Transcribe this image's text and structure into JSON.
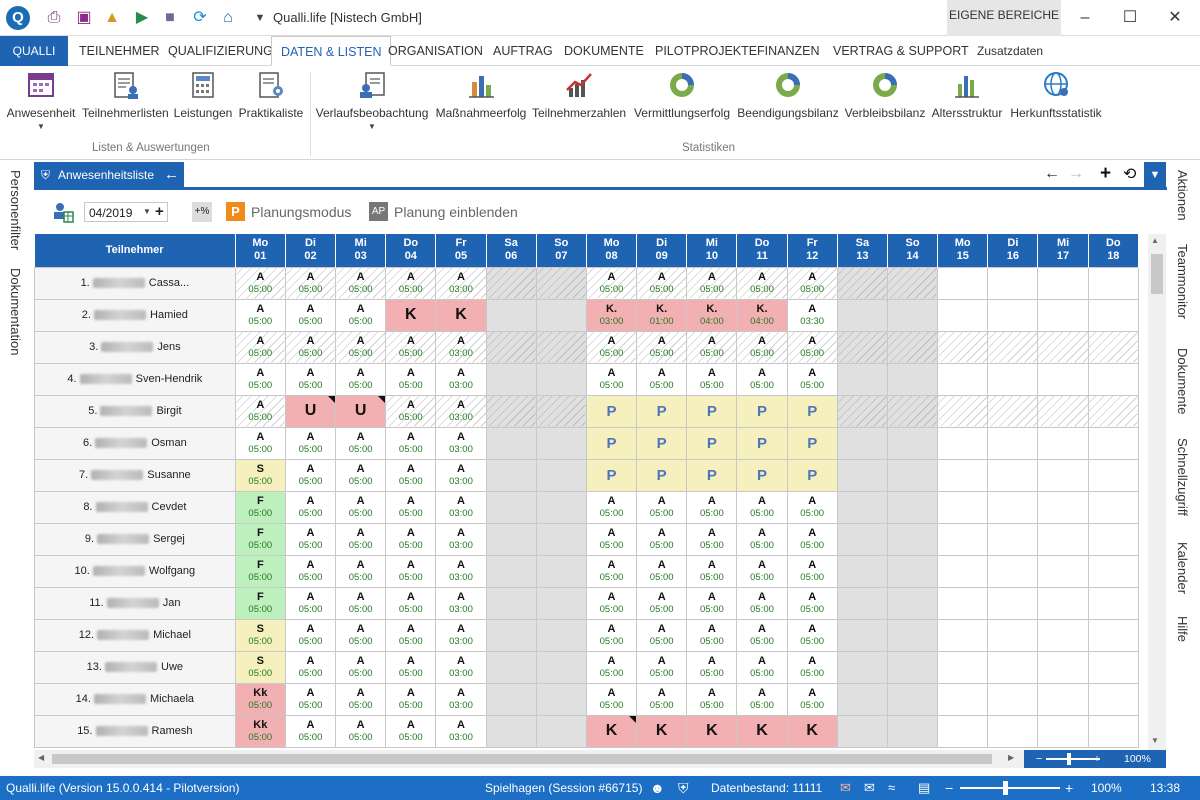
{
  "window": {
    "title": "Qualli.life [Nistech GmbH]",
    "eigene_bereiche": "EIGENE BEREICHE"
  },
  "menu": {
    "app": "QUALLI",
    "items": [
      "TEILNEHMER",
      "QUALIFIZIERUNG",
      "DATEN & LISTEN",
      "ORGANISATION",
      "AUFTRAG",
      "DOKUMENTE",
      "PILOTPROJEKTE",
      "FINANZEN",
      "VERTRAG & SUPPORT"
    ],
    "active": "DATEN & LISTEN",
    "zusatz": "Zusatzdaten"
  },
  "ribbon": {
    "group1": "Listen & Auswertungen",
    "group2": "Statistiken",
    "buttons": [
      "Anwesenheit",
      "Teilnehmerlisten",
      "Leistungen",
      "Praktikaliste",
      "Verlaufsbeobachtung",
      "Maßnahmeerfolg",
      "Teilnehmerzahlen",
      "Vermittlungserfolg",
      "Beendigungsbilanz",
      "Verbleibsbilanz",
      "Altersstruktur",
      "Herkunftsstatistik"
    ]
  },
  "left_rail": [
    "Personenfilter",
    "Dokumentation"
  ],
  "right_rail": [
    "Aktionen",
    "Teammonitor",
    "Dokumente",
    "Schnellzugriff",
    "Kalender",
    "Hilfe"
  ],
  "panel": {
    "tab": "Anwesenheitsliste"
  },
  "toolbar": {
    "month": "04/2019",
    "percent": "+%",
    "planning_mode": "Planungsmodus",
    "planning_show": "Planung einblenden",
    "plan_badge": "P",
    "ap_badge": "AP"
  },
  "grid": {
    "header_name": "Teilnehmer",
    "days": [
      {
        "dow": "Mo",
        "d": "01"
      },
      {
        "dow": "Di",
        "d": "02"
      },
      {
        "dow": "Mi",
        "d": "03"
      },
      {
        "dow": "Do",
        "d": "04"
      },
      {
        "dow": "Fr",
        "d": "05"
      },
      {
        "dow": "Sa",
        "d": "06"
      },
      {
        "dow": "So",
        "d": "07"
      },
      {
        "dow": "Mo",
        "d": "08"
      },
      {
        "dow": "Di",
        "d": "09"
      },
      {
        "dow": "Mi",
        "d": "10"
      },
      {
        "dow": "Do",
        "d": "11"
      },
      {
        "dow": "Fr",
        "d": "12"
      },
      {
        "dow": "Sa",
        "d": "13"
      },
      {
        "dow": "So",
        "d": "14"
      },
      {
        "dow": "Mo",
        "d": "15"
      },
      {
        "dow": "Di",
        "d": "16"
      },
      {
        "dow": "Mi",
        "d": "17"
      },
      {
        "dow": "Do",
        "d": "18"
      }
    ],
    "rows": [
      {
        "num": "1.",
        "name": "Cassa...",
        "cells": [
          "A|05:00",
          "A|05:00",
          "A|05:00",
          "A|05:00",
          "A|03:00",
          "",
          "",
          "A|05:00",
          "A|05:00",
          "A|05:00",
          "A|05:00",
          "A|05:00"
        ]
      },
      {
        "num": "2.",
        "name": "Hamied",
        "cells": [
          "A|05:00",
          "A|05:00",
          "A|05:00",
          "K",
          "K",
          "",
          "",
          "K.|03:00",
          "K.|01:00",
          "K.|04:00",
          "K.|04:00",
          "A|03:30"
        ]
      },
      {
        "num": "3.",
        "name": "Jens",
        "cells": [
          "A|05:00",
          "A|05:00",
          "A|05:00",
          "A|05:00",
          "A|03:00",
          "",
          "",
          "A|05:00",
          "A|05:00",
          "A|05:00",
          "A|05:00",
          "A|05:00"
        ]
      },
      {
        "num": "4.",
        "name": "Sven-Hendrik",
        "cells": [
          "A|05:00",
          "A|05:00",
          "A|05:00",
          "A|05:00",
          "A|03:00",
          "",
          "",
          "A|05:00",
          "A|05:00",
          "A|05:00",
          "A|05:00",
          "A|05:00"
        ]
      },
      {
        "num": "5.",
        "name": "Birgit",
        "cells": [
          "A|05:00",
          "U",
          "U",
          "A|05:00",
          "A|03:00",
          "",
          "",
          "P",
          "P",
          "P",
          "P",
          "P"
        ]
      },
      {
        "num": "6.",
        "name": "Osman",
        "cells": [
          "A|05:00",
          "A|05:00",
          "A|05:00",
          "A|05:00",
          "A|03:00",
          "",
          "",
          "P",
          "P",
          "P",
          "P",
          "P"
        ]
      },
      {
        "num": "7.",
        "name": "Susanne",
        "cells": [
          "S|05:00",
          "A|05:00",
          "A|05:00",
          "A|05:00",
          "A|03:00",
          "",
          "",
          "P",
          "P",
          "P",
          "P",
          "P"
        ]
      },
      {
        "num": "8.",
        "name": "Cevdet",
        "cells": [
          "F|05:00",
          "A|05:00",
          "A|05:00",
          "A|05:00",
          "A|03:00",
          "",
          "",
          "A|05:00",
          "A|05:00",
          "A|05:00",
          "A|05:00",
          "A|05:00"
        ]
      },
      {
        "num": "9.",
        "name": "Sergej",
        "cells": [
          "F|05:00",
          "A|05:00",
          "A|05:00",
          "A|05:00",
          "A|03:00",
          "",
          "",
          "A|05:00",
          "A|05:00",
          "A|05:00",
          "A|05:00",
          "A|05:00"
        ]
      },
      {
        "num": "10.",
        "name": "Wolfgang",
        "cells": [
          "F|05:00",
          "A|05:00",
          "A|05:00",
          "A|05:00",
          "A|03:00",
          "",
          "",
          "A|05:00",
          "A|05:00",
          "A|05:00",
          "A|05:00",
          "A|05:00"
        ]
      },
      {
        "num": "11.",
        "name": "Jan",
        "cells": [
          "F|05:00",
          "A|05:00",
          "A|05:00",
          "A|05:00",
          "A|03:00",
          "",
          "",
          "A|05:00",
          "A|05:00",
          "A|05:00",
          "A|05:00",
          "A|05:00"
        ]
      },
      {
        "num": "12.",
        "name": "Michael",
        "cells": [
          "S|05:00",
          "A|05:00",
          "A|05:00",
          "A|05:00",
          "A|03:00",
          "",
          "",
          "A|05:00",
          "A|05:00",
          "A|05:00",
          "A|05:00",
          "A|05:00"
        ]
      },
      {
        "num": "13.",
        "name": "Uwe",
        "cells": [
          "S|05:00",
          "A|05:00",
          "A|05:00",
          "A|05:00",
          "A|03:00",
          "",
          "",
          "A|05:00",
          "A|05:00",
          "A|05:00",
          "A|05:00",
          "A|05:00"
        ]
      },
      {
        "num": "14.",
        "name": "Michaela",
        "cells": [
          "Kk|05:00",
          "A|05:00",
          "A|05:00",
          "A|05:00",
          "A|03:00",
          "",
          "",
          "A|05:00",
          "A|05:00",
          "A|05:00",
          "A|05:00",
          "A|05:00"
        ]
      },
      {
        "num": "15.",
        "name": "Ramesh",
        "cells": [
          "Kk|05:00",
          "A|05:00",
          "A|05:00",
          "A|05:00",
          "A|03:00",
          "",
          "",
          "K",
          "K",
          "K",
          "K",
          "K"
        ]
      }
    ]
  },
  "zoom": {
    "label": "100%"
  },
  "status": {
    "version": "Qualli.life (Version 15.0.0.414 - Pilotversion)",
    "session": "Spielhagen (Session #66715)",
    "datenbestand": "Datenbestand: 11111",
    "zoom": "100%",
    "time": "13:38"
  },
  "colors": {
    "accent": "#1f63b3",
    "absent": "#f3b0b3",
    "planned": "#f5f0bd",
    "free": "#bdf0bd",
    "time_text": "#237a23"
  }
}
